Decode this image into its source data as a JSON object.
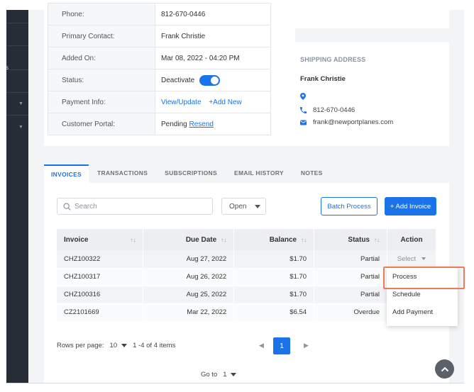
{
  "sidebar": {
    "letter": "s"
  },
  "customer": {
    "rows": [
      {
        "label": "Phone:",
        "value": "812-670-0446"
      },
      {
        "label": "Primary Contact:",
        "value": "Frank Christie"
      },
      {
        "label": "Added On:",
        "value": "Mar 08, 2022 - 04:20 PM"
      },
      {
        "label": "Status:",
        "value": "Deactivate"
      },
      {
        "label": "Payment Info:",
        "link1": "View/Update",
        "link2": "+Add New"
      },
      {
        "label": "Customer Portal:",
        "value": "Pending",
        "link": "Resend"
      }
    ]
  },
  "shipping": {
    "title": "SHIPPING ADDRESS",
    "name": "Frank Christie",
    "location": "",
    "phone": "812-670-0446",
    "email": "frank@newportplanes.com"
  },
  "tabs": [
    "INVOICES",
    "TRANSACTIONS",
    "SUBSCRIPTIONS",
    "EMAIL HISTORY",
    "NOTES"
  ],
  "toolbar": {
    "search_placeholder": "Search",
    "filter_value": "Open",
    "batch_label": "Batch Process",
    "add_label": "+ Add Invoice"
  },
  "table": {
    "headers": [
      "Invoice",
      "Due Date",
      "Balance",
      "Status",
      "Action"
    ],
    "rows": [
      {
        "invoice": "CHZ100322",
        "due": "Aug 27, 2022",
        "balance": "$1.70",
        "status": "Partial",
        "action": "Select"
      },
      {
        "invoice": "CHZ100317",
        "due": "Aug 26, 2022",
        "balance": "$1.70",
        "status": "Partial",
        "action": ""
      },
      {
        "invoice": "CHZ100316",
        "due": "Aug 25, 2022",
        "balance": "$1.70",
        "status": "Partial",
        "action": ""
      },
      {
        "invoice": "CZ2101669",
        "due": "Mar 22, 2022",
        "balance": "$6.54",
        "status": "Overdue",
        "action": ""
      }
    ]
  },
  "action_menu": [
    "Process",
    "Schedule",
    "Add Payment"
  ],
  "pagination": {
    "rows_per_page_label": "Rows per page:",
    "rows_per_page": "10",
    "range": "1 -4 of 4  items",
    "current_page": "1",
    "goto_label": "Go to",
    "goto_value": "1"
  },
  "colors": {
    "accent": "#1a73e8",
    "highlight": "#ee7b57",
    "sidebar": "#272d36"
  }
}
